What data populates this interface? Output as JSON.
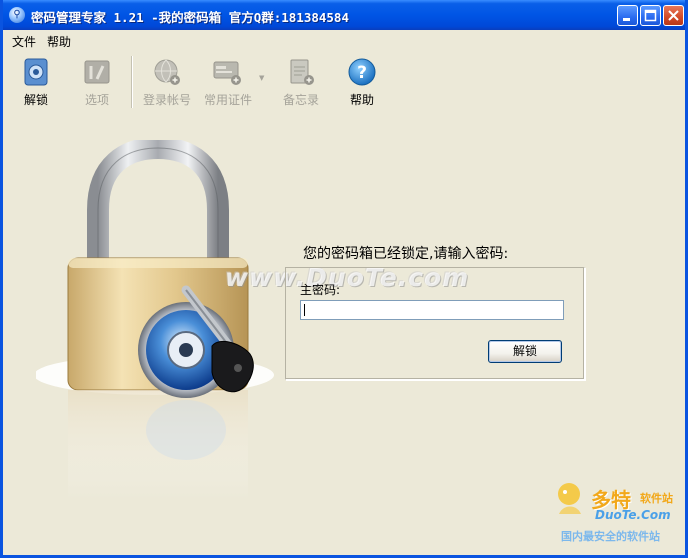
{
  "window": {
    "title": "密码管理专家 1.21 -我的密码箱 官方Q群:181384584"
  },
  "menu": {
    "items": [
      {
        "label": "文件"
      },
      {
        "label": "帮助"
      }
    ]
  },
  "toolbar": {
    "unlock": {
      "label": "解锁",
      "icon": "safe-icon"
    },
    "options": {
      "label": "选项",
      "icon": "tools-icon"
    },
    "accounts": {
      "label": "登录帐号",
      "icon": "globe-add-icon"
    },
    "documents": {
      "label": "常用证件",
      "icon": "cards-add-icon"
    },
    "memo": {
      "label": "备忘录",
      "icon": "notepad-add-icon"
    },
    "help": {
      "label": "帮助",
      "icon": "help-icon"
    }
  },
  "lock_panel": {
    "prompt": "您的密码箱已经锁定,请输入密码:",
    "password_label": "主密码:",
    "password_value": "",
    "unlock_button": "解锁"
  },
  "watermark": {
    "text": "www.DuoTe.com"
  },
  "site_badge": {
    "name": "多特",
    "sub": "软件站",
    "url": "DuoTe.Com",
    "slogan": "国内最安全的软件站"
  },
  "colors": {
    "titlebar": "#0055e5",
    "window_bg": "#ece9d8",
    "help_icon": "#1a8ad8",
    "badge_orange": "#f2a81a"
  }
}
